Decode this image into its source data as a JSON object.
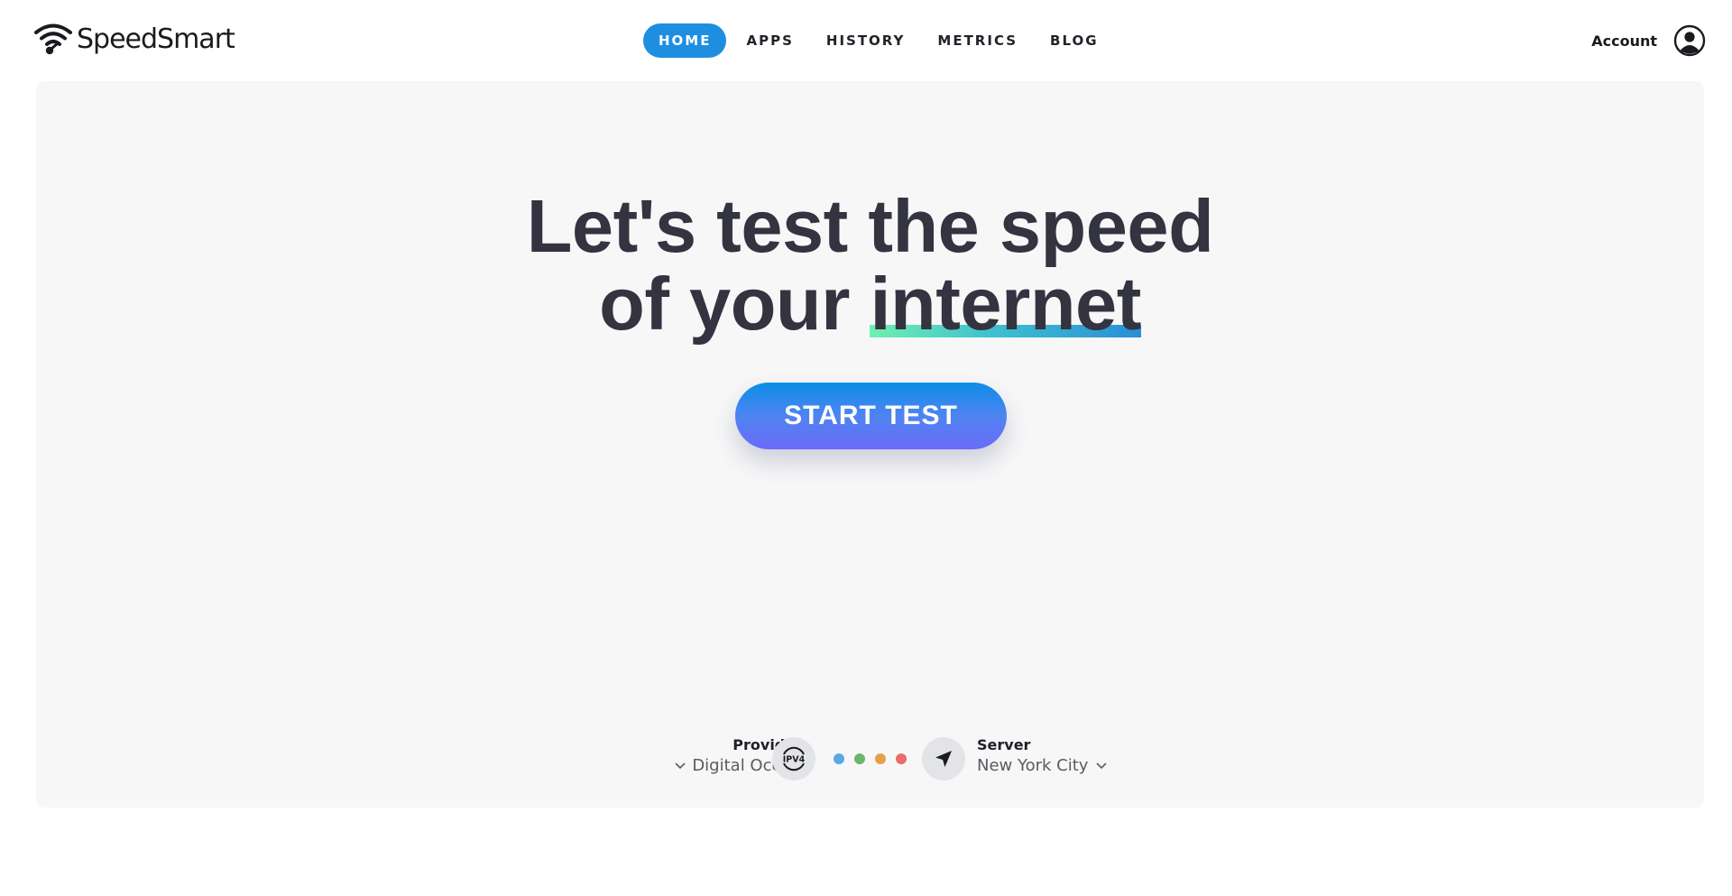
{
  "brand": {
    "name": "SpeedSmart",
    "logo_icon": "wifi-icon"
  },
  "nav": {
    "items": [
      {
        "label": "HOME",
        "active": true
      },
      {
        "label": "APPS",
        "active": false
      },
      {
        "label": "HISTORY",
        "active": false
      },
      {
        "label": "METRICS",
        "active": false
      },
      {
        "label": "BLOG",
        "active": false
      }
    ],
    "active_color": "#1e8ee0"
  },
  "account": {
    "label": "Account",
    "icon": "user-circle-icon"
  },
  "hero": {
    "line1": "Let's test the speed",
    "line2_prefix": "of your ",
    "line2_highlight": "internet",
    "highlight_gradient": [
      "#6ff0b0",
      "#3fc0d0",
      "#2a8ed6"
    ]
  },
  "start_button": {
    "label": "START TEST",
    "gradient": [
      "#0a8ee6",
      "#6b6bf8"
    ]
  },
  "provider": {
    "label": "Provider",
    "value": "Digital Ocean",
    "icon": "chevron-down-icon"
  },
  "protocol": {
    "badge": "IPV4",
    "icon": "ipv4-icon"
  },
  "status_dots": [
    "#5aa9e6",
    "#6db56d",
    "#e6a04c",
    "#e96d6d"
  ],
  "server": {
    "label": "Server",
    "value": "New York City",
    "icon": "navigation-arrow-icon"
  }
}
